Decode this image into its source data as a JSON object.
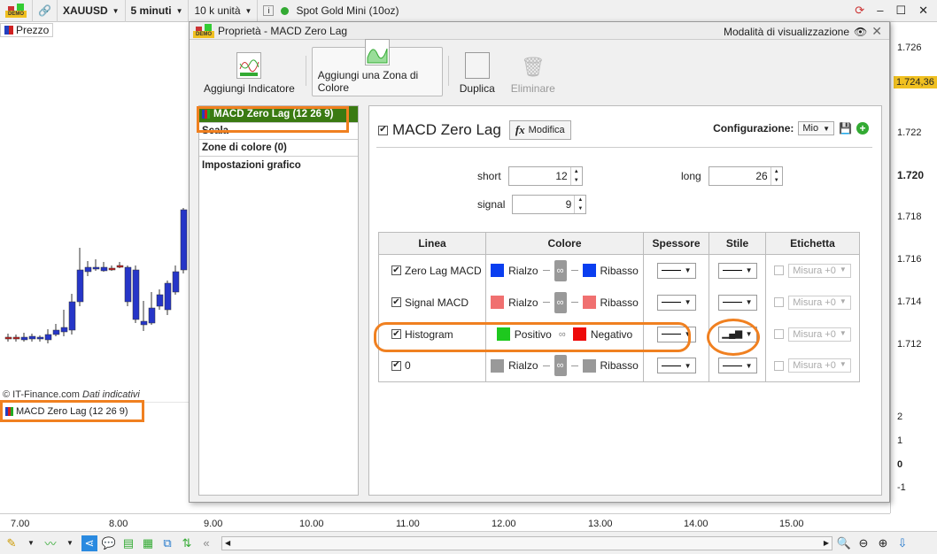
{
  "topbar": {
    "symbol": "XAUUSD",
    "timeframe": "5 minuti",
    "units": "10 k unità",
    "instrument": "Spot Gold Mini (10oz)",
    "status_color": "#3a3"
  },
  "chart": {
    "legend": "Prezzo",
    "copyright": "© IT-Finance.com",
    "copyright_note": "Dati indicativi",
    "macd_legend": "MACD Zero Lag (12 26 9)",
    "price_labels": [
      "1.726",
      "1.724,36",
      "1.722",
      "1.720",
      "1.718",
      "1.716",
      "1.714",
      "1.712"
    ],
    "macd_labels": [
      "2",
      "1",
      "0",
      "-1"
    ],
    "time_labels": [
      "7.00",
      "8.00",
      "9.00",
      "10.00",
      "11.00",
      "12.00",
      "13.00",
      "14.00",
      "15.00"
    ],
    "current_price_color": "#f0c020"
  },
  "dialog": {
    "title": "Proprietà - MACD Zero Lag",
    "mode_label": "Modalità di visualizzazione",
    "toolbar": {
      "add_indicator": "Aggiungi Indicatore",
      "add_zone": "Aggiungi una Zona di Colore",
      "duplicate": "Duplica",
      "delete": "Eliminare"
    },
    "left_items": [
      "MACD Zero Lag (12 26 9)",
      "Scala",
      "Zone di colore (0)",
      "Impostazioni grafico"
    ],
    "indicator_name": "MACD Zero Lag",
    "modify": "Modifica",
    "config_label": "Configurazione:",
    "config_value": "Mio",
    "params": {
      "short_label": "short",
      "short": "12",
      "long_label": "long",
      "long": "26",
      "signal_label": "signal",
      "signal": "9"
    },
    "columns": [
      "Linea",
      "Colore",
      "Spessore",
      "Stile",
      "Etichetta"
    ],
    "rows": [
      {
        "name": "Zero Lag MACD",
        "up": "Rialzo",
        "down": "Ribasso",
        "up_color": "#0a3ef0",
        "down_color": "#0a3ef0",
        "label": "Misura +0",
        "linked": true
      },
      {
        "name": "Signal MACD",
        "up": "Rialzo",
        "down": "Ribasso",
        "up_color": "#f07070",
        "down_color": "#f07070",
        "label": "Misura +0",
        "linked": true
      },
      {
        "name": "Histogram",
        "up": "Positivo",
        "down": "Negativo",
        "up_color": "#1ec81e",
        "down_color": "#ee0a0a",
        "label": "Misura +0",
        "linked": false
      },
      {
        "name": "0",
        "up": "Rialzo",
        "down": "Ribasso",
        "up_color": "#999999",
        "down_color": "#999999",
        "label": "Misura +0",
        "linked": true
      }
    ]
  }
}
